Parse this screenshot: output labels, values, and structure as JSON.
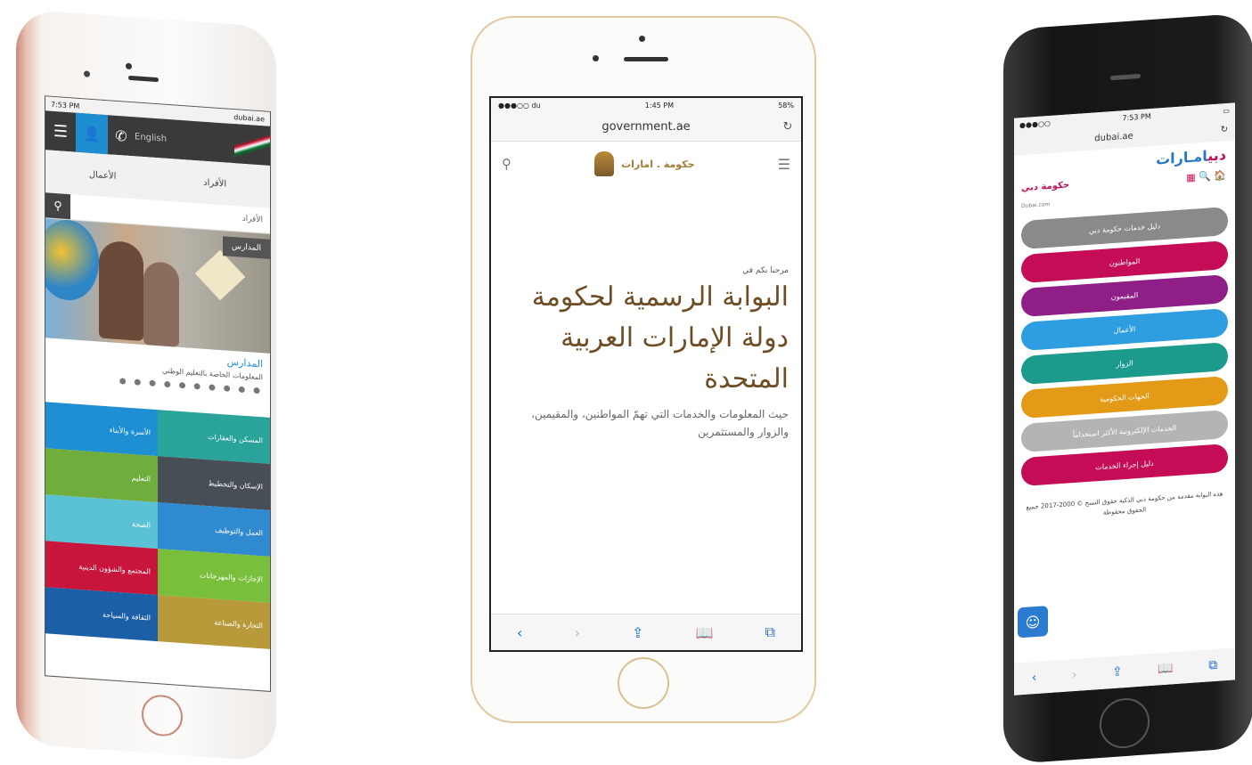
{
  "left_phone": {
    "status_time": "7:53 PM",
    "status_url": "dubai.ae",
    "header": {
      "menu_icon": "☰",
      "user_icon": "👤",
      "phone_icon": "✆",
      "lang": "English"
    },
    "toggle": {
      "left": "الأعمال",
      "right": "الأفراد"
    },
    "search_placeholder": "الأفراد",
    "hero_button": "المدارس",
    "section_title": "المدارس",
    "section_subtitle": "المعلومات الخاصة بالتعليم الوطني",
    "dots": "● ● ● ● ● ● ● ● ● ●",
    "tiles": [
      {
        "label": "الأسرة والأبناء",
        "color": "#1f8fd3"
      },
      {
        "label": "المسكن والعقارات",
        "color": "#2aa39a"
      },
      {
        "label": "التعليم",
        "color": "#6fae3c"
      },
      {
        "label": "الإسكان والتخطيط",
        "color": "#474e56"
      },
      {
        "label": "الصحة",
        "color": "#5bc2d6"
      },
      {
        "label": "العمل والتوظيف",
        "color": "#2f8ad0"
      },
      {
        "label": "المجتمع والشؤون الدينية",
        "color": "#c8153c"
      },
      {
        "label": "الإجازات والمهرجانات",
        "color": "#7abf3b"
      },
      {
        "label": "الثقافة والسياحة",
        "color": "#1b5fa6"
      },
      {
        "label": "التجارة والصناعة",
        "color": "#b89a3a"
      }
    ]
  },
  "middle_phone": {
    "status_left": "●●●○○ du",
    "status_time": "1:45 PM",
    "status_right": "58%",
    "url": "government.ae",
    "reload_icon": "↻",
    "search_icon": "⚲",
    "logo_text": "حكومة . امارات",
    "menu_icon": "☰",
    "welcome": "مرحبا بكم في",
    "title": "البوابة الرسمية لحكومة دولة الإمارات العربية المتحدة",
    "description": "حيث المعلومات والخدمات التي تهمّ المواطنين، والمقيمين، والزوار والمستثمرين",
    "bottom_icons": [
      "‹",
      "›",
      "⇪",
      "📖",
      "⧉"
    ]
  },
  "right_phone": {
    "status_time": "7:53 PM",
    "url": "dubai.ae",
    "reload_icon": "↻",
    "brand_blue": "امـارات",
    "brand_red": "دبي",
    "icons_row": "▦ 🔍 🏠",
    "small_logo": "حكومة دبي",
    "small_sub": "Dubai.com",
    "buttons": [
      {
        "label": "دليل خدمات حكومة دبي",
        "color": "#8a8a8a"
      },
      {
        "label": "المواطنون",
        "color": "#c40d56"
      },
      {
        "label": "المقيمون",
        "color": "#8f1f86"
      },
      {
        "label": "الأعمال",
        "color": "#2f9ee0"
      },
      {
        "label": "الزوار",
        "color": "#1c9b8d"
      },
      {
        "label": "الجهات الحكومية",
        "color": "#e39a17"
      },
      {
        "label": "الخدمات الإلكترونية الأكثر استخداماً",
        "color": "#b4b4b4"
      },
      {
        "label": "دليل إجراء الخدمات",
        "color": "#c40d56"
      }
    ],
    "footer": "هذه البوابة مقدمة من حكومة دبي الذكية حقوق النسخ © 2000-2017 جميع الحقوق محفوظة",
    "chat_icon": "☺",
    "bottom_icons": [
      "‹",
      "›",
      "⇪",
      "📖",
      "⧉"
    ]
  }
}
